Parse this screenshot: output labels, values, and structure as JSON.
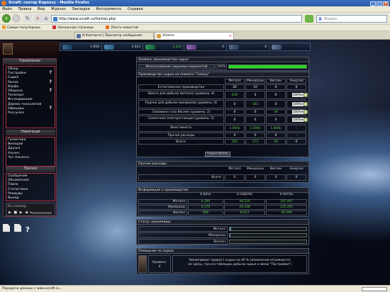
{
  "browser": {
    "title": "Xcraft: сектор Корпоху - Mozilla Firefox",
    "menu": [
      "Файл",
      "Правка",
      "Вид",
      "Журнал",
      "Закладки",
      "Инструменты",
      "Справка"
    ],
    "url": "http://www.xcraft.ru/frames.php",
    "search_placeholder": "Яндекс",
    "bookmarks": [
      "Самые популярные",
      "Начальная страница",
      "Лента новостей"
    ],
    "tabs": [
      {
        "label": "В Контакте | Просмотр сообщения",
        "active": false
      },
      {
        "label": "XGame",
        "active": true
      }
    ],
    "status": "Передача данных с www.xcraft.ru..."
  },
  "resources": [
    "2.856",
    "2.023",
    "1.224",
    "0",
    "0"
  ],
  "left": {
    "header": "Управление",
    "menu": [
      {
        "label": "Обзор",
        "help": false
      },
      {
        "label": "Постройки",
        "help": true
      },
      {
        "label": "Сырьё",
        "help": false
      },
      {
        "label": "Рынок",
        "help": true
      },
      {
        "label": "Верфь",
        "help": false
      },
      {
        "label": "Оборона",
        "help": true
      },
      {
        "label": "Телепорт",
        "help": false
      },
      {
        "label": "Исследования",
        "help": false
      },
      {
        "label": "Дерево технологий",
        "help": false
      },
      {
        "label": "Офицеры",
        "help": true
      },
      {
        "label": "Рассылка",
        "help": false
      }
    ],
    "nav_header": "Навигация",
    "nav": [
      "Галактика",
      "Империя",
      "Друзья",
      "Альянс",
      "Чат Альянса"
    ],
    "other_header": "Прочее",
    "other": [
      "Сообщения",
      "Объявления",
      "Поиск",
      "Статистика",
      "Рекорды",
      "Выход"
    ],
    "player_text": "It's coming..."
  },
  "production_level": {
    "title": "Уровень производства сырья",
    "label": "Использование сырьевых мощностей",
    "percent": "100%",
    "fill": 1.0
  },
  "planet_production": {
    "title": "Производство сырья на планете \"Colony\"",
    "headers": [
      "Металл",
      "Минералы",
      "Веспен",
      "Энергия"
    ],
    "rows": [
      {
        "name": "Естественное производство",
        "values": [
          "20",
          "10",
          "0",
          "0"
        ],
        "colors": [
          "white",
          "white",
          "white",
          "white"
        ],
        "pct": ""
      },
      {
        "name": "Шахта для добычи металла (уровень: 4)",
        "values": [
          "245",
          "0",
          "0",
          "-55"
        ],
        "colors": [
          "green",
          "white",
          "white",
          "red"
        ],
        "pct": "100%"
      },
      {
        "name": "Рудник для добычи минералов (уровень: 4)",
        "values": [
          "0",
          "163",
          "0",
          "-55"
        ],
        "colors": [
          "white",
          "green",
          "white",
          "red"
        ],
        "pct": "100%"
      },
      {
        "name": "Скважина газа Веспен (уровень: 2)",
        "values": [
          "0",
          "0",
          "39",
          "-40"
        ],
        "colors": [
          "white",
          "white",
          "green",
          "red"
        ],
        "pct": "100%"
      },
      {
        "name": "Солнечная электростанция (уровень: 5)",
        "values": [
          "0",
          "0",
          "0",
          "167"
        ],
        "colors": [
          "white",
          "white",
          "white",
          "green"
        ],
        "pct": "100%"
      },
      {
        "name": "Вместимость",
        "values": [
          "1.000k",
          "1.000k",
          "1.000k",
          "-"
        ],
        "colors": [
          "green",
          "green",
          "green",
          "white"
        ],
        "pct": ""
      },
      {
        "name": "Прочие расходы",
        "values": [
          "0",
          "0",
          "0",
          "-"
        ],
        "colors": [
          "white",
          "white",
          "white",
          "white"
        ],
        "pct": ""
      },
      {
        "name": "Всего:",
        "values": [
          "265",
          "173",
          "39",
          "0"
        ],
        "colors": [
          "green",
          "green",
          "green",
          "white"
        ],
        "pct": ""
      }
    ],
    "button": "Пересчитать"
  },
  "other_costs": {
    "title": "Прочие расходы",
    "headers": [
      "Металл",
      "Минералы",
      "Веспен",
      "Энергия"
    ],
    "row_label": "Всего:",
    "values": [
      "0",
      "0",
      "0",
      "0"
    ]
  },
  "info": {
    "title": "Информация о производстве",
    "headers": [
      "в день",
      "в неделю",
      "в месяц"
    ],
    "rows": [
      {
        "name": "Металл",
        "values": [
          "6.360",
          "44.520",
          "191.497"
        ]
      },
      {
        "name": "Минералы",
        "values": [
          "4.175",
          "29.228",
          "125.265"
        ]
      },
      {
        "name": "Веспен",
        "values": [
          "946",
          "6.623",
          "28.396"
        ]
      }
    ]
  },
  "storage": {
    "title": "Статус хранилища",
    "rows": [
      {
        "name": "Металл",
        "fill": 0.02
      },
      {
        "name": "Минералы",
        "fill": 0.01
      },
      {
        "name": "Веспен",
        "fill": 0.0
      }
    ]
  },
  "help": {
    "title": "Помощник по сырью",
    "level_label": "Уровень:",
    "level": "4",
    "text": "Увеличивает прирост сырья на 40 % (изменения отражаются не здесь, так и в таблицах добычи сырья в меню \"Постройки\")"
  },
  "colors": {
    "accent_green": "#22d822",
    "value_green": "#5ed04a",
    "value_red": "#e84040",
    "panel_border": "#b03040"
  }
}
